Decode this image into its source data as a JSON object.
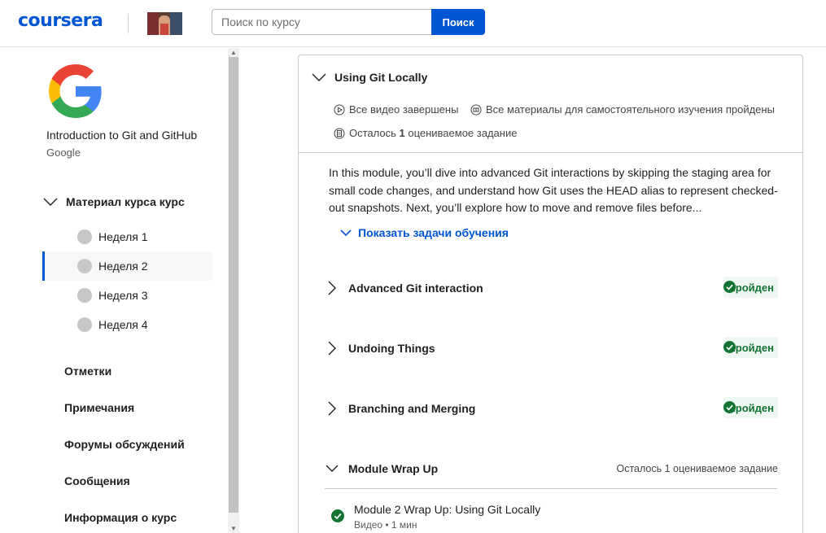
{
  "header": {
    "logo": "coursera",
    "search_placeholder": "Поиск по курсу",
    "search_button": "Поиск"
  },
  "sidebar": {
    "course_title": "Introduction to Git and GitHub",
    "course_org": "Google",
    "section_label": "Материал курса курс",
    "weeks": [
      {
        "label": "Неделя 1",
        "active": false
      },
      {
        "label": "Неделя 2",
        "active": true
      },
      {
        "label": "Неделя 3",
        "active": false
      },
      {
        "label": "Неделя 4",
        "active": false
      }
    ],
    "nav": [
      "Отметки",
      "Примечания",
      "Форумы обсуждений",
      "Сообщения",
      "Информация о курс"
    ]
  },
  "module": {
    "title": "Using Git Locally",
    "status_videos": "Все видео завершены",
    "status_readings": "Все материалы для самостоятельного изучения пройдены",
    "status_remaining_pre": "Осталось ",
    "status_remaining_count": "1",
    "status_remaining_post": " оцениваемое задание",
    "description": "In this module, you’ll dive into advanced Git interactions by skipping the staging area for small code changes, and understand how Git uses the HEAD alias to represent checked-out snapshots. Next, you’ll explore how to move and remove files before...",
    "show_objectives": "Показать задачи обучения",
    "lessons": [
      {
        "name": "Advanced Git interaction",
        "status": "Пройден"
      },
      {
        "name": "Undoing Things",
        "status": "Пройден"
      },
      {
        "name": "Branching and Merging",
        "status": "Пройден"
      }
    ],
    "wrap_up": {
      "name": "Module Wrap Up",
      "remaining": "Осталось 1 оцениваемое задание",
      "item_title": "Module 2 Wrap Up: Using Git Locally",
      "item_meta": "Видео • 1 мин"
    }
  },
  "colors": {
    "brand": "#0056d2",
    "success": "#137333",
    "success_bg": "#eef7f1"
  }
}
